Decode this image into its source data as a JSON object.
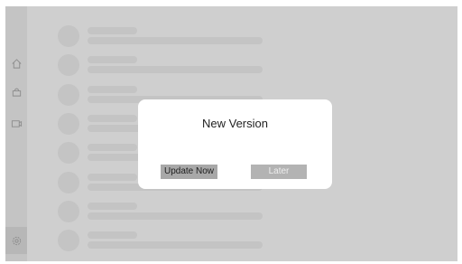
{
  "sidebar": {
    "items": [
      {
        "icon": "home-icon"
      },
      {
        "icon": "bag-icon"
      },
      {
        "icon": "camera-icon"
      },
      {
        "icon": "settings-icon",
        "selected": true
      }
    ]
  },
  "dialog": {
    "title": "New Version",
    "update_label": "Update Now",
    "later_label": "Later"
  },
  "colors": {
    "background": "#cfcfcf",
    "sidebar": "#c4c4c4",
    "placeholder": "#c4c4c4",
    "dialog": "#ffffff",
    "update_button": "#a8a8a8",
    "later_button": "#b3b3b3"
  }
}
